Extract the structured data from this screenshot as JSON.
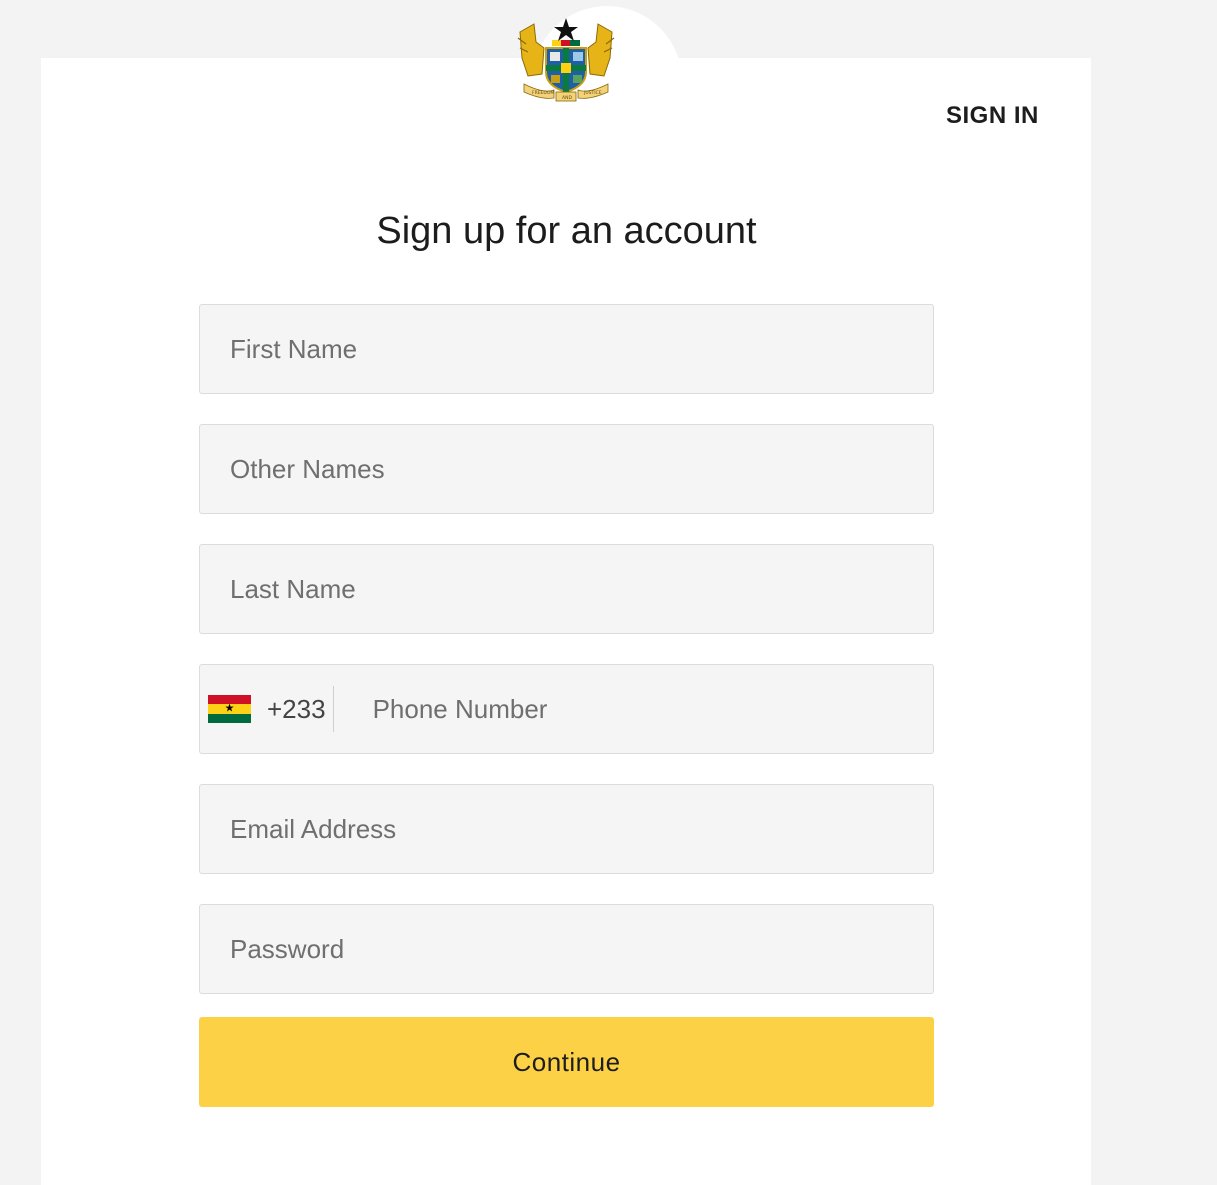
{
  "header": {
    "emblem": "ghana-coat-of-arms",
    "emblem_motto_left": "FREEDOM",
    "emblem_motto_center": "AND",
    "emblem_motto_right": "JUSTICE",
    "signin_label": "SIGN IN"
  },
  "form": {
    "title": "Sign up for an account",
    "first_name": {
      "placeholder": "First Name",
      "value": ""
    },
    "other_names": {
      "placeholder": "Other Names",
      "value": ""
    },
    "last_name": {
      "placeholder": "Last Name",
      "value": ""
    },
    "phone": {
      "country_flag": "ghana-flag",
      "dial_code": "+233",
      "placeholder": "Phone Number",
      "value": ""
    },
    "email": {
      "placeholder": "Email Address",
      "value": ""
    },
    "password": {
      "placeholder": "Password",
      "value": ""
    },
    "submit_label": "Continue"
  },
  "colors": {
    "page_background": "#f3f3f3",
    "card_background": "#ffffff",
    "field_background": "#f5f5f5",
    "field_border": "#dcdcdc",
    "button_background": "#fdd146",
    "flag_red": "#ce1126",
    "flag_gold": "#fcd116",
    "flag_green": "#006b3f"
  }
}
